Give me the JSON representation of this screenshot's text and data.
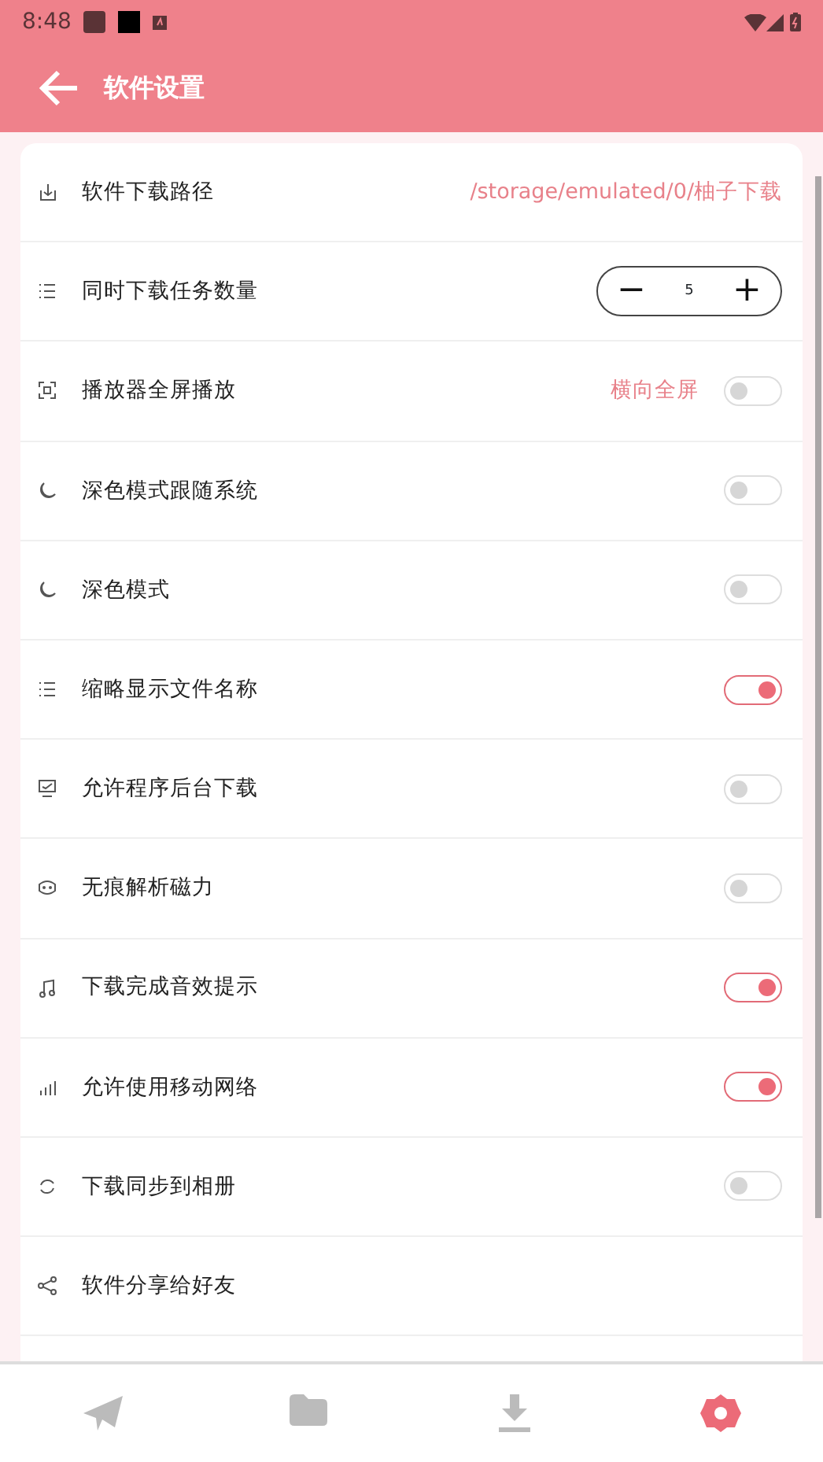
{
  "status_bar": {
    "time": "8:48"
  },
  "app_bar": {
    "title": "软件设置"
  },
  "settings": [
    {
      "kind": "value",
      "label": "软件下载路径",
      "value": "/storage/emulated/0/柚子下载"
    },
    {
      "kind": "stepper",
      "label": "同时下载任务数量",
      "minus": "−",
      "value": "5",
      "plus": "+"
    },
    {
      "kind": "toggle",
      "label": "播放器全屏播放",
      "hint": "横向全屏",
      "on": false
    },
    {
      "kind": "toggle",
      "label": "深色模式跟随系统",
      "on": false
    },
    {
      "kind": "toggle",
      "label": "深色模式",
      "on": false
    },
    {
      "kind": "toggle",
      "label": "缩略显示文件名称",
      "on": true
    },
    {
      "kind": "toggle",
      "label": "允许程序后台下载",
      "on": false
    },
    {
      "kind": "toggle",
      "label": "无痕解析磁力",
      "on": false
    },
    {
      "kind": "toggle",
      "label": "下载完成音效提示",
      "on": true
    },
    {
      "kind": "toggle",
      "label": "允许使用移动网络",
      "on": true
    },
    {
      "kind": "toggle",
      "label": "下载同步到相册",
      "on": false
    },
    {
      "kind": "link",
      "label": "软件分享给好友"
    }
  ],
  "bottom_nav": [
    {
      "selected": false
    },
    {
      "selected": false
    },
    {
      "selected": false
    },
    {
      "selected": true
    }
  ]
}
